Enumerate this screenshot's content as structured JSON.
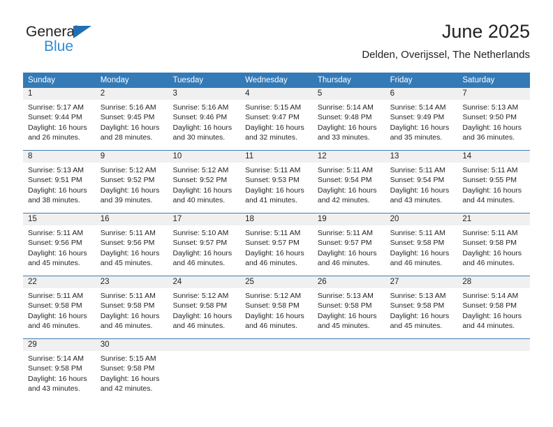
{
  "logo": {
    "word1": "General",
    "word2": "Blue",
    "triangle_color": "#1f6fb5",
    "word2_color": "#2e8bd4"
  },
  "header": {
    "title": "June 2025",
    "subtitle": "Delden, Overijssel, The Netherlands"
  },
  "theme": {
    "header_band": "#337ab7",
    "daynum_band": "#f0f0f0",
    "week_divider": "#3f7cb4",
    "text": "#231f20"
  },
  "calendar": {
    "weekday_headers": [
      "Sunday",
      "Monday",
      "Tuesday",
      "Wednesday",
      "Thursday",
      "Friday",
      "Saturday"
    ],
    "weeks": [
      [
        {
          "day": "1",
          "sunrise": "Sunrise: 5:17 AM",
          "sunset": "Sunset: 9:44 PM",
          "daylight": "Daylight: 16 hours and 26 minutes."
        },
        {
          "day": "2",
          "sunrise": "Sunrise: 5:16 AM",
          "sunset": "Sunset: 9:45 PM",
          "daylight": "Daylight: 16 hours and 28 minutes."
        },
        {
          "day": "3",
          "sunrise": "Sunrise: 5:16 AM",
          "sunset": "Sunset: 9:46 PM",
          "daylight": "Daylight: 16 hours and 30 minutes."
        },
        {
          "day": "4",
          "sunrise": "Sunrise: 5:15 AM",
          "sunset": "Sunset: 9:47 PM",
          "daylight": "Daylight: 16 hours and 32 minutes."
        },
        {
          "day": "5",
          "sunrise": "Sunrise: 5:14 AM",
          "sunset": "Sunset: 9:48 PM",
          "daylight": "Daylight: 16 hours and 33 minutes."
        },
        {
          "day": "6",
          "sunrise": "Sunrise: 5:14 AM",
          "sunset": "Sunset: 9:49 PM",
          "daylight": "Daylight: 16 hours and 35 minutes."
        },
        {
          "day": "7",
          "sunrise": "Sunrise: 5:13 AM",
          "sunset": "Sunset: 9:50 PM",
          "daylight": "Daylight: 16 hours and 36 minutes."
        }
      ],
      [
        {
          "day": "8",
          "sunrise": "Sunrise: 5:13 AM",
          "sunset": "Sunset: 9:51 PM",
          "daylight": "Daylight: 16 hours and 38 minutes."
        },
        {
          "day": "9",
          "sunrise": "Sunrise: 5:12 AM",
          "sunset": "Sunset: 9:52 PM",
          "daylight": "Daylight: 16 hours and 39 minutes."
        },
        {
          "day": "10",
          "sunrise": "Sunrise: 5:12 AM",
          "sunset": "Sunset: 9:52 PM",
          "daylight": "Daylight: 16 hours and 40 minutes."
        },
        {
          "day": "11",
          "sunrise": "Sunrise: 5:11 AM",
          "sunset": "Sunset: 9:53 PM",
          "daylight": "Daylight: 16 hours and 41 minutes."
        },
        {
          "day": "12",
          "sunrise": "Sunrise: 5:11 AM",
          "sunset": "Sunset: 9:54 PM",
          "daylight": "Daylight: 16 hours and 42 minutes."
        },
        {
          "day": "13",
          "sunrise": "Sunrise: 5:11 AM",
          "sunset": "Sunset: 9:54 PM",
          "daylight": "Daylight: 16 hours and 43 minutes."
        },
        {
          "day": "14",
          "sunrise": "Sunrise: 5:11 AM",
          "sunset": "Sunset: 9:55 PM",
          "daylight": "Daylight: 16 hours and 44 minutes."
        }
      ],
      [
        {
          "day": "15",
          "sunrise": "Sunrise: 5:11 AM",
          "sunset": "Sunset: 9:56 PM",
          "daylight": "Daylight: 16 hours and 45 minutes."
        },
        {
          "day": "16",
          "sunrise": "Sunrise: 5:11 AM",
          "sunset": "Sunset: 9:56 PM",
          "daylight": "Daylight: 16 hours and 45 minutes."
        },
        {
          "day": "17",
          "sunrise": "Sunrise: 5:10 AM",
          "sunset": "Sunset: 9:57 PM",
          "daylight": "Daylight: 16 hours and 46 minutes."
        },
        {
          "day": "18",
          "sunrise": "Sunrise: 5:11 AM",
          "sunset": "Sunset: 9:57 PM",
          "daylight": "Daylight: 16 hours and 46 minutes."
        },
        {
          "day": "19",
          "sunrise": "Sunrise: 5:11 AM",
          "sunset": "Sunset: 9:57 PM",
          "daylight": "Daylight: 16 hours and 46 minutes."
        },
        {
          "day": "20",
          "sunrise": "Sunrise: 5:11 AM",
          "sunset": "Sunset: 9:58 PM",
          "daylight": "Daylight: 16 hours and 46 minutes."
        },
        {
          "day": "21",
          "sunrise": "Sunrise: 5:11 AM",
          "sunset": "Sunset: 9:58 PM",
          "daylight": "Daylight: 16 hours and 46 minutes."
        }
      ],
      [
        {
          "day": "22",
          "sunrise": "Sunrise: 5:11 AM",
          "sunset": "Sunset: 9:58 PM",
          "daylight": "Daylight: 16 hours and 46 minutes."
        },
        {
          "day": "23",
          "sunrise": "Sunrise: 5:11 AM",
          "sunset": "Sunset: 9:58 PM",
          "daylight": "Daylight: 16 hours and 46 minutes."
        },
        {
          "day": "24",
          "sunrise": "Sunrise: 5:12 AM",
          "sunset": "Sunset: 9:58 PM",
          "daylight": "Daylight: 16 hours and 46 minutes."
        },
        {
          "day": "25",
          "sunrise": "Sunrise: 5:12 AM",
          "sunset": "Sunset: 9:58 PM",
          "daylight": "Daylight: 16 hours and 46 minutes."
        },
        {
          "day": "26",
          "sunrise": "Sunrise: 5:13 AM",
          "sunset": "Sunset: 9:58 PM",
          "daylight": "Daylight: 16 hours and 45 minutes."
        },
        {
          "day": "27",
          "sunrise": "Sunrise: 5:13 AM",
          "sunset": "Sunset: 9:58 PM",
          "daylight": "Daylight: 16 hours and 45 minutes."
        },
        {
          "day": "28",
          "sunrise": "Sunrise: 5:14 AM",
          "sunset": "Sunset: 9:58 PM",
          "daylight": "Daylight: 16 hours and 44 minutes."
        }
      ],
      [
        {
          "day": "29",
          "sunrise": "Sunrise: 5:14 AM",
          "sunset": "Sunset: 9:58 PM",
          "daylight": "Daylight: 16 hours and 43 minutes."
        },
        {
          "day": "30",
          "sunrise": "Sunrise: 5:15 AM",
          "sunset": "Sunset: 9:58 PM",
          "daylight": "Daylight: 16 hours and 42 minutes."
        },
        {
          "day": "",
          "sunrise": "",
          "sunset": "",
          "daylight": ""
        },
        {
          "day": "",
          "sunrise": "",
          "sunset": "",
          "daylight": ""
        },
        {
          "day": "",
          "sunrise": "",
          "sunset": "",
          "daylight": ""
        },
        {
          "day": "",
          "sunrise": "",
          "sunset": "",
          "daylight": ""
        },
        {
          "day": "",
          "sunrise": "",
          "sunset": "",
          "daylight": ""
        }
      ]
    ]
  }
}
